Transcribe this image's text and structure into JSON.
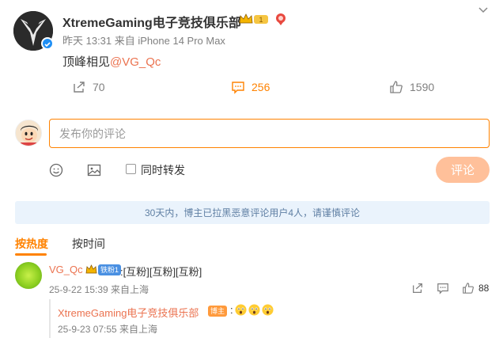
{
  "post": {
    "author": "XtremeGaming电子竞技俱乐部",
    "badge_level": "1",
    "meta": "昨天 13:31 来自 iPhone 14 Pro Max",
    "text_prefix": "顶峰相见",
    "mention": "@VG_Qc"
  },
  "actions": {
    "repost_count": "70",
    "comment_count": "256",
    "like_count": "1590"
  },
  "composer": {
    "placeholder": "发布你的评论",
    "repost_label": "同时转发",
    "submit_label": "评论"
  },
  "notice": "30天内，博主已拉黑恶意评论用户4人，请谨慎评论",
  "tabs": {
    "hot": "按热度",
    "time": "按时间"
  },
  "comments": [
    {
      "user": "VG_Qc",
      "fan_badge": "铁粉1",
      "text": ":[互粉][互粉][互粉]",
      "meta": "25-9-22 15:39 来自上海",
      "like_count": "88",
      "reply": {
        "user": "XtremeGaming电子竞技俱乐部",
        "badge": "博主",
        "text": ":",
        "emoji_count": 3,
        "meta": "25-9-23 07:55 来自上海"
      }
    }
  ],
  "colors": {
    "accent": "#ff8200",
    "link": "#eb7350",
    "notice_bg": "#eaf3fc",
    "notice_text": "#5f7fa3",
    "submit_disabled": "#ffc09a"
  }
}
